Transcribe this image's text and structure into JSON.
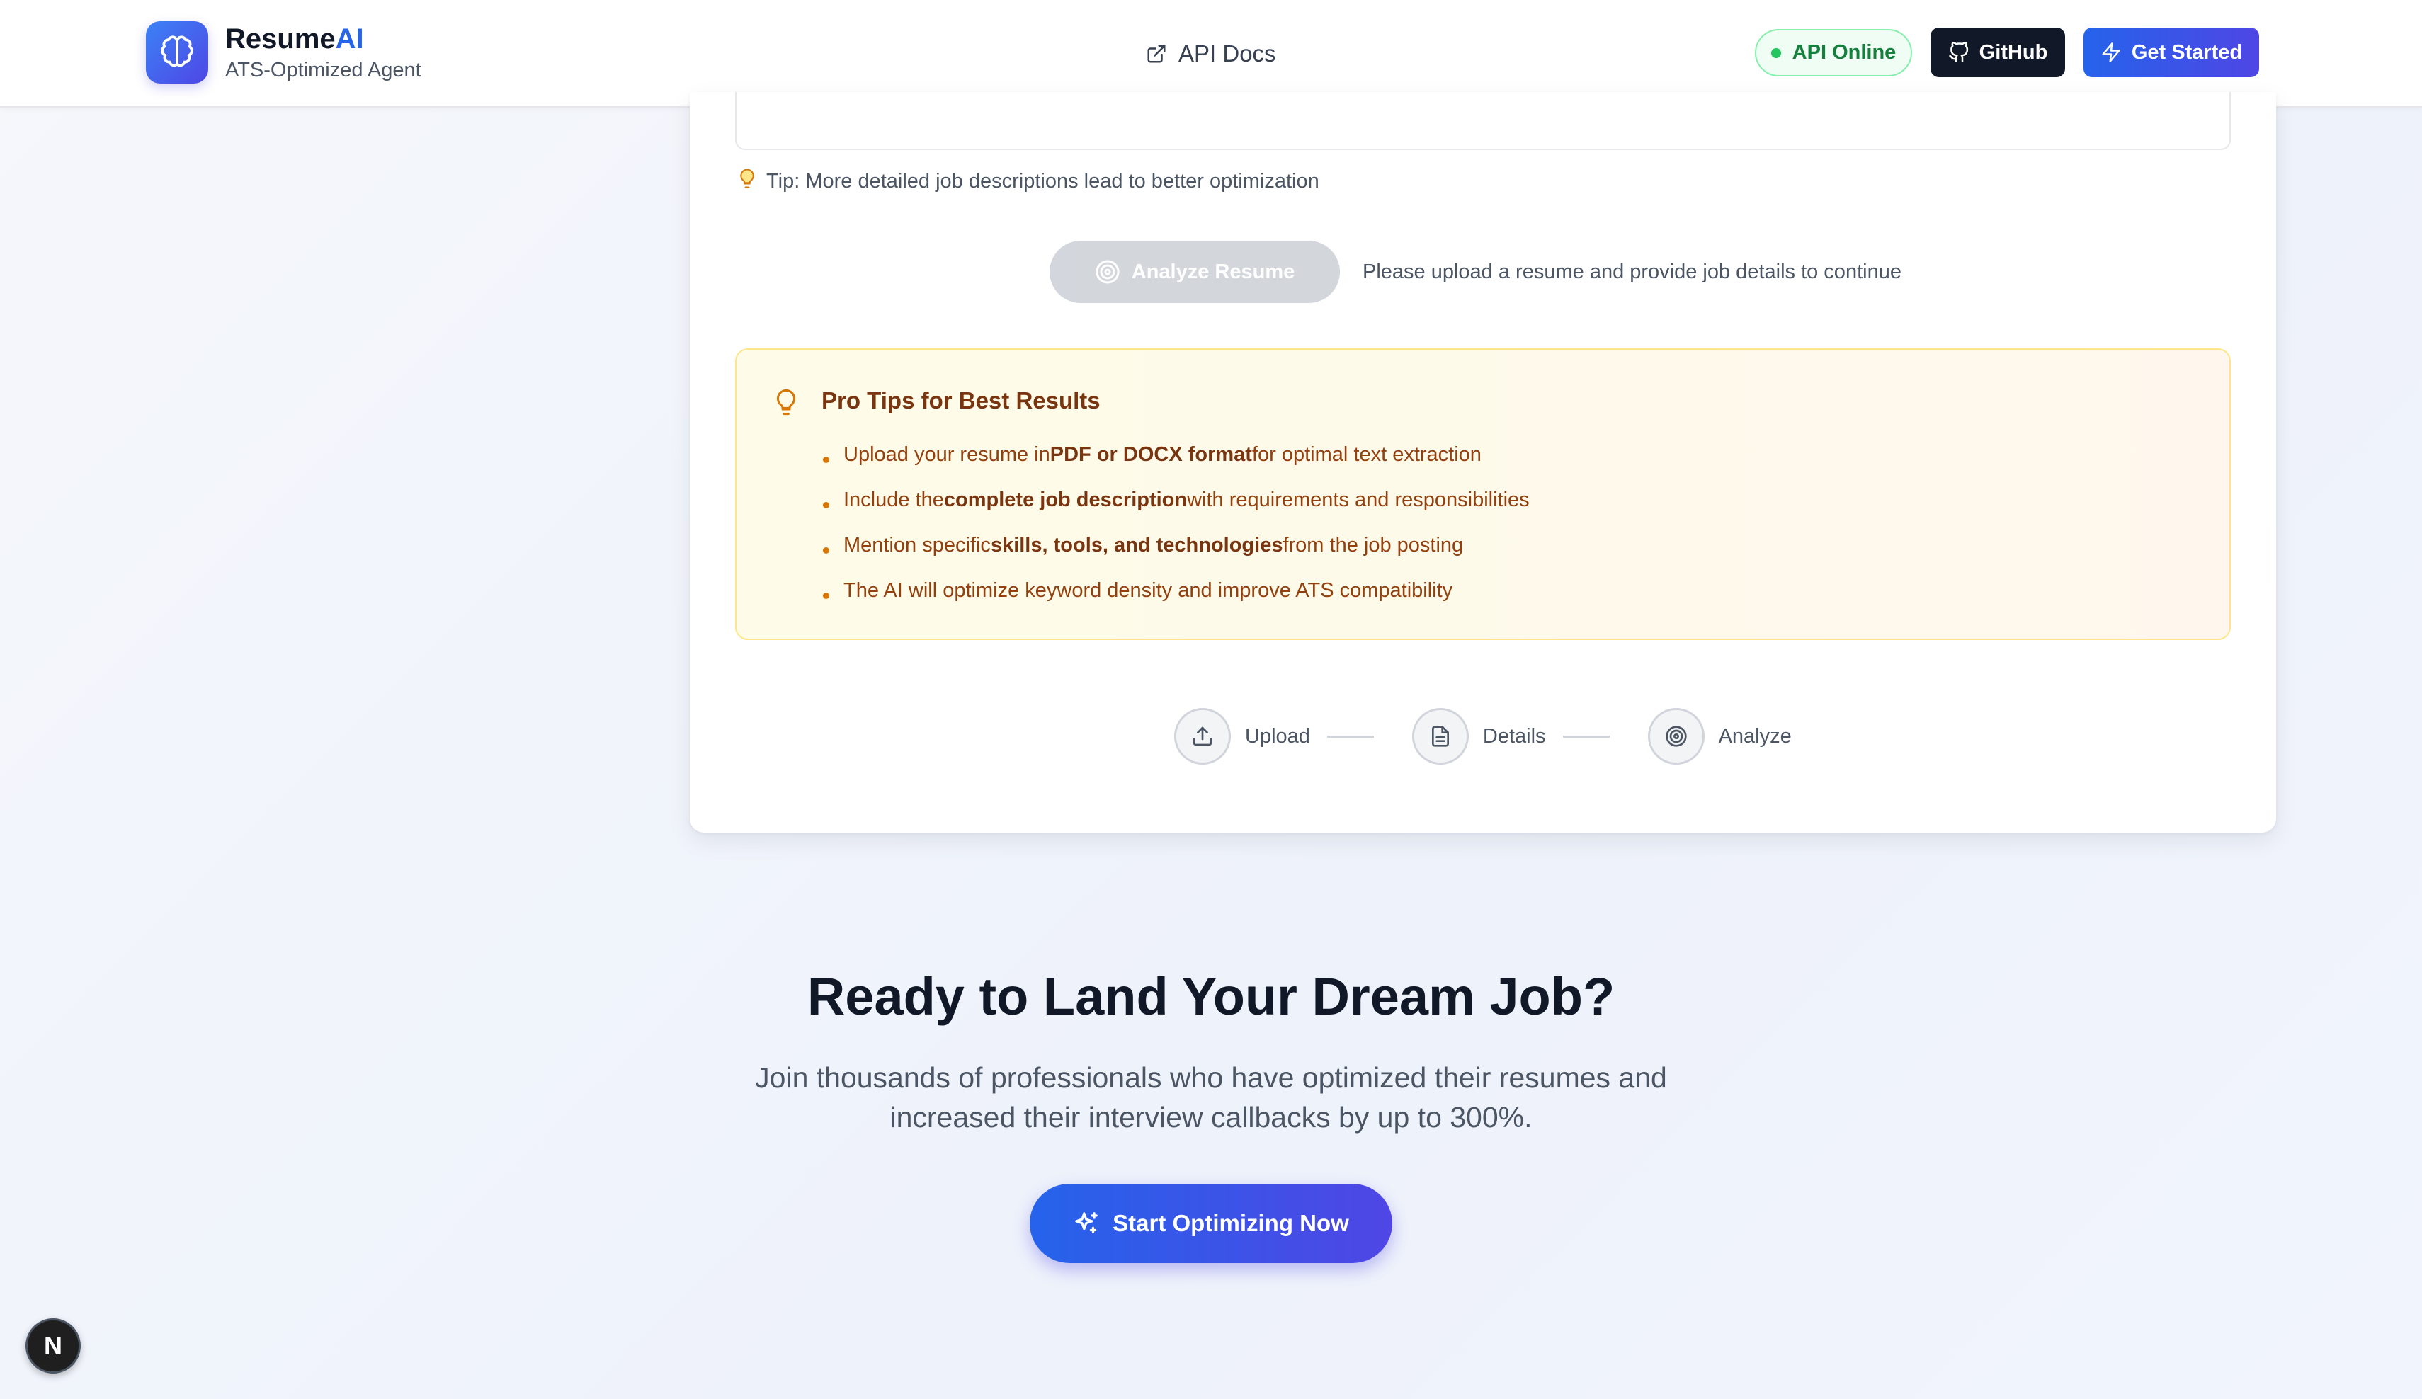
{
  "header": {
    "brand_name_main": "Resume",
    "brand_name_accent": "AI",
    "brand_subtitle": "ATS-Optimized Agent",
    "brand_icon": "brain-icon",
    "api_docs_label": "API Docs",
    "api_docs_icon": "external-link-icon",
    "status_label": "API Online",
    "status_color": "#22c55e",
    "github_label": "GitHub",
    "github_icon": "github-icon",
    "get_started_label": "Get Started",
    "get_started_icon": "zap-icon"
  },
  "form": {
    "tip": "Tip: More detailed job descriptions lead to better optimization",
    "tip_icon": "lightbulb-icon",
    "analyze_button_label": "Analyze Resume",
    "analyze_button_icon": "target-icon",
    "analyze_hint": "Please upload a resume and provide job details to continue"
  },
  "pro_tips": {
    "title": "Pro Tips for Best Results",
    "icon": "lightbulb-icon",
    "items": [
      {
        "before": "Upload your resume in ",
        "bold": "PDF or DOCX format",
        "after": " for optimal text extraction"
      },
      {
        "before": "Include the ",
        "bold": "complete job description",
        "after": " with requirements and responsibilities"
      },
      {
        "before": "Mention specific ",
        "bold": "skills, tools, and technologies",
        "after": " from the job posting"
      },
      {
        "before": "The AI will optimize keyword density and improve ATS compatibility",
        "bold": "",
        "after": ""
      }
    ]
  },
  "steps": [
    {
      "label": "Upload",
      "icon": "upload-icon"
    },
    {
      "label": "Details",
      "icon": "file-text-icon"
    },
    {
      "label": "Analyze",
      "icon": "target-icon"
    }
  ],
  "cta": {
    "title": "Ready to Land Your Dream Job?",
    "subtitle_line1": "Join thousands of professionals who have optimized their resumes and",
    "subtitle_line2": "increased their interview callbacks by up to 300%.",
    "button_label": "Start Optimizing Now",
    "button_icon": "sparkles-icon"
  },
  "dev_badge": {
    "label": "N"
  },
  "colors": {
    "brand_blue": "#2563eb",
    "brand_indigo": "#4f46e5",
    "tips_text": "#92400e",
    "disabled_button": "#d1d5db"
  }
}
